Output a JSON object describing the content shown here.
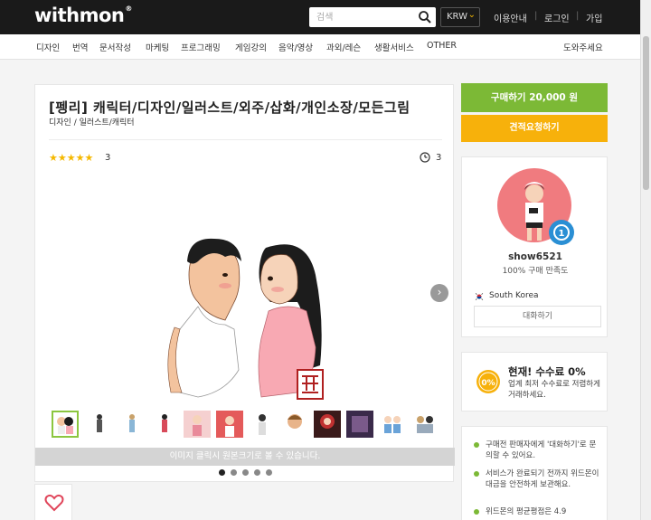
{
  "header": {
    "logo": "withmon",
    "logo_mark": "®",
    "search_placeholder": "검색",
    "currency": "KRW",
    "links": [
      "이용안내",
      "로그인",
      "가입"
    ]
  },
  "nav": {
    "categories": [
      "디자인",
      "번역",
      "문서작성",
      "마케팅",
      "프로그래밍",
      "게임강의",
      "음악/영상",
      "과외/레슨",
      "생활서비스",
      "OTHER"
    ],
    "help": "도와주세요"
  },
  "service": {
    "title": "[펭리] 캐릭터/디자인/일러스트/외주/삽화/개인소장/모든그림",
    "breadcrumb": "디자인 / 일러스트/캐릭터",
    "stars": "★★★★★",
    "rating_count": "3",
    "delivery_days": "3",
    "image_caption": "이미지 클릭시 원본크기로 볼 수 있습니다.",
    "thumbnail_count": 12,
    "active_dot": 0,
    "dot_count": 5
  },
  "purchase": {
    "buy_label": "구매하기 20,000 원",
    "quote_label": "견적요청하기"
  },
  "seller": {
    "name": "show6521",
    "satisfaction": "100% 구매 만족도",
    "level": "1",
    "country": "South Korea",
    "chat_label": "대화하기"
  },
  "fee": {
    "icon_text": "0%",
    "title": "현재! 수수료 0%",
    "description": "업계 최저 수수료로 저렴하게 거래하세요."
  },
  "info": {
    "items": [
      "구매전 판매자에게 '대화하기'로 문의할 수 있어요.",
      "서비스가 완료되기 전까지 위드몬이 대금을 안전하게 보관해요.",
      "위드몬의 평균평점은 4.9"
    ]
  },
  "colors": {
    "accent_green": "#7cb936",
    "accent_yellow": "#f7b10b",
    "header_bg": "#1a1a1a"
  }
}
